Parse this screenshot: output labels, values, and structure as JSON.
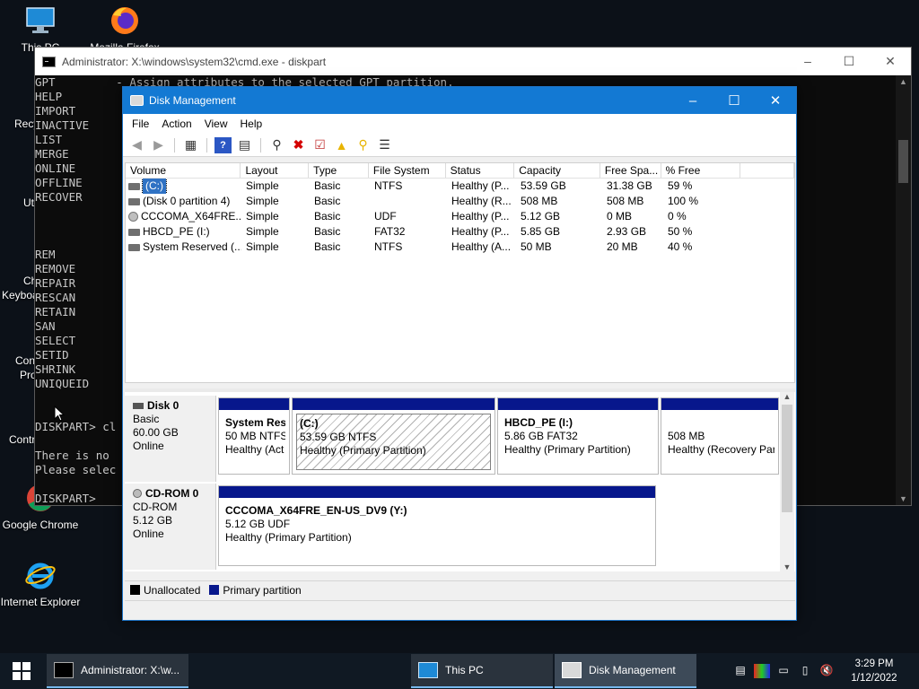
{
  "desktop": {
    "icons": [
      {
        "label": "This PC",
        "icon": "this-pc-icon"
      },
      {
        "label": "Mozilla Firefox",
        "icon": "firefox-icon"
      },
      {
        "label": "Google Chrome",
        "icon": "chrome-icon"
      },
      {
        "label": "Internet Explorer",
        "icon": "internet-explorer-icon"
      }
    ],
    "partial_labels": [
      "Recy",
      "Ut",
      "Ch",
      "Keyboa",
      "Con",
      "Pro",
      "Contr"
    ]
  },
  "cmd": {
    "title": "Administrator: X:\\windows\\system32\\cmd.exe - diskpart",
    "lines": [
      "GPT         - Assign attributes to the selected GPT partition.",
      "HELP",
      "IMPORT",
      "INACTIVE",
      "LIST",
      "MERGE",
      "ONLINE",
      "OFFLINE",
      "RECOVER",
      "",
      "",
      "",
      "REM",
      "REMOVE",
      "REPAIR",
      "RESCAN",
      "RETAIN",
      "SAN",
      "SELECT",
      "SETID",
      "SHRINK",
      "UNIQUEID",
      "",
      "",
      "DISKPART> cl",
      "",
      "There is no",
      "Please selec",
      "",
      "DISKPART>"
    ]
  },
  "dm": {
    "title": "Disk Management",
    "menu": [
      "File",
      "Action",
      "View",
      "Help"
    ],
    "columns": [
      "Volume",
      "Layout",
      "Type",
      "File System",
      "Status",
      "Capacity",
      "Free Spa...",
      "% Free",
      ""
    ],
    "volumes": [
      {
        "icon": "drive",
        "name": "(C:)",
        "layout": "Simple",
        "type": "Basic",
        "fs": "NTFS",
        "status": "Healthy (P...",
        "capacity": "53.59 GB",
        "free": "31.38 GB",
        "pct": "59 %"
      },
      {
        "icon": "drive",
        "name": "(Disk 0 partition 4)",
        "layout": "Simple",
        "type": "Basic",
        "fs": "",
        "status": "Healthy (R...",
        "capacity": "508 MB",
        "free": "508 MB",
        "pct": "100 %"
      },
      {
        "icon": "cd",
        "name": "CCCOMA_X64FRE...",
        "layout": "Simple",
        "type": "Basic",
        "fs": "UDF",
        "status": "Healthy (P...",
        "capacity": "5.12 GB",
        "free": "0 MB",
        "pct": "0 %"
      },
      {
        "icon": "drive",
        "name": "HBCD_PE (I:)",
        "layout": "Simple",
        "type": "Basic",
        "fs": "FAT32",
        "status": "Healthy (P...",
        "capacity": "5.85 GB",
        "free": "2.93 GB",
        "pct": "50 %"
      },
      {
        "icon": "drive",
        "name": "System Reserved (...",
        "layout": "Simple",
        "type": "Basic",
        "fs": "NTFS",
        "status": "Healthy (A...",
        "capacity": "50 MB",
        "free": "20 MB",
        "pct": "40 %"
      }
    ],
    "disks": [
      {
        "name": "Disk 0",
        "kind": "Basic",
        "size": "60.00 GB",
        "state": "Online",
        "partitions": [
          {
            "title": "System Rese",
            "line2": "50 MB NTFS",
            "line3": "Healthy (Act"
          },
          {
            "title": "(C:)",
            "line2": "53.59 GB NTFS",
            "line3": "Healthy (Primary Partition)"
          },
          {
            "title": "HBCD_PE  (I:)",
            "line2": "5.86 GB FAT32",
            "line3": "Healthy (Primary Partition)"
          },
          {
            "title": "",
            "line2": "508 MB",
            "line3": "Healthy (Recovery Par"
          }
        ]
      },
      {
        "name": "CD-ROM 0",
        "kind": "CD-ROM",
        "size": "5.12 GB",
        "state": "Online",
        "partitions": [
          {
            "title": "CCCOMA_X64FRE_EN-US_DV9  (Y:)",
            "line2": "5.12 GB UDF",
            "line3": "Healthy (Primary Partition)"
          }
        ]
      }
    ],
    "legend": [
      {
        "label": "Unallocated",
        "color": "#000000"
      },
      {
        "label": "Primary partition",
        "color": "#07178c"
      }
    ]
  },
  "taskbar": {
    "buttons": [
      {
        "label": "Administrator: X:\\w..."
      },
      {
        "label": "This PC"
      },
      {
        "label": "Disk Management"
      }
    ],
    "time": "3:29 PM",
    "date": "1/12/2022"
  }
}
